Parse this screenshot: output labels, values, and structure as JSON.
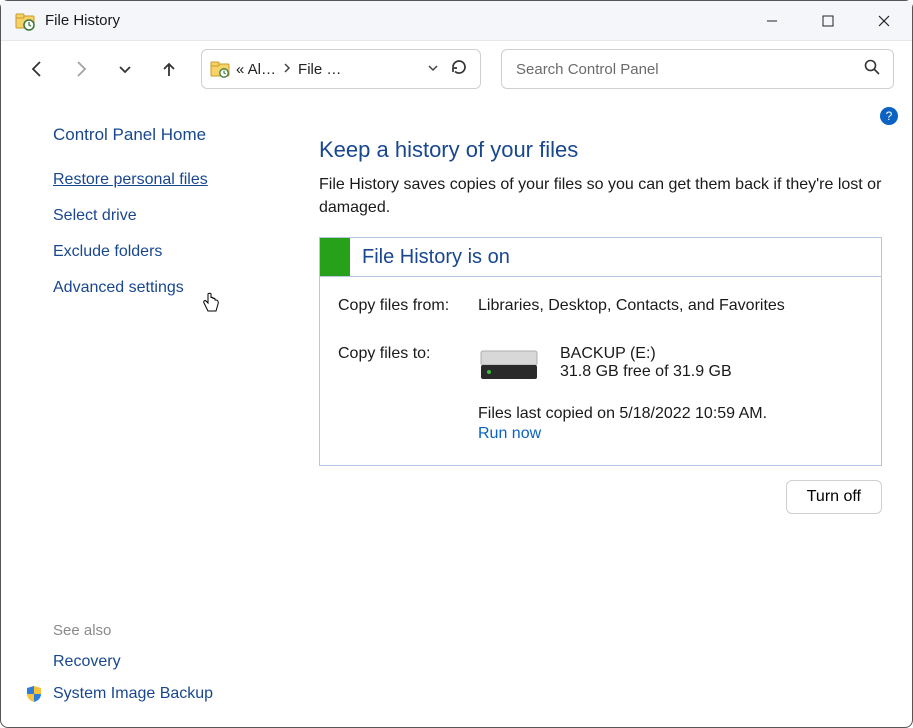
{
  "window": {
    "title": "File History"
  },
  "address": {
    "seg1": "« Al…",
    "seg2": "File …"
  },
  "search": {
    "placeholder": "Search Control Panel"
  },
  "sidebar": {
    "home": "Control Panel Home",
    "links": [
      "Restore personal files",
      "Select drive",
      "Exclude folders",
      "Advanced settings"
    ],
    "see_also": "See also",
    "footer": [
      "Recovery",
      "System Image Backup"
    ]
  },
  "main": {
    "heading": "Keep a history of your files",
    "description": "File History saves copies of your files so you can get them back if they're lost or damaged.",
    "status_title": "File History is on",
    "copy_from_label": "Copy files from:",
    "copy_from_value": "Libraries, Desktop, Contacts, and Favorites",
    "copy_to_label": "Copy files to:",
    "drive_name": "BACKUP (E:)",
    "drive_space": "31.8 GB free of 31.9 GB",
    "last_copied": "Files last copied on 5/18/2022 10:59 AM.",
    "run_now": "Run now",
    "turn_off": "Turn off"
  },
  "colors": {
    "accent": "#19478f",
    "status_on": "#28a11a",
    "link": "#0a63c2"
  }
}
